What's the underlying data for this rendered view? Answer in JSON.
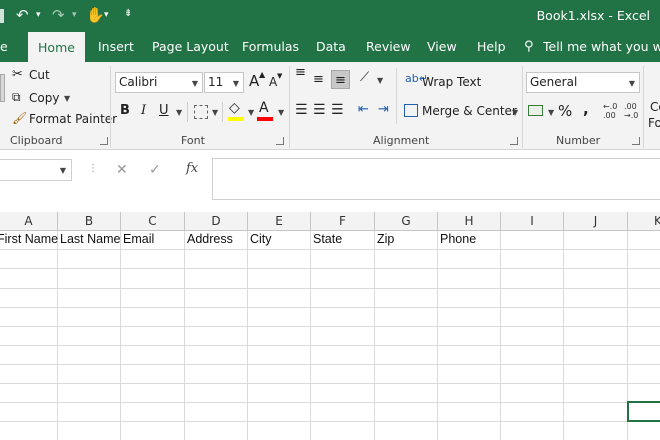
{
  "titlebar": {
    "title": "Book1.xlsx  -  Excel"
  },
  "tabs": [
    "e",
    "Home",
    "Insert",
    "Page Layout",
    "Formulas",
    "Data",
    "Review",
    "View",
    "Help"
  ],
  "tell_me": "Tell me what you want",
  "clipboard": {
    "cut": "Cut",
    "copy": "Copy",
    "format_painter": "Format Painter",
    "label": "Clipboard"
  },
  "font": {
    "name": "Calibri",
    "size": "11",
    "grow": "A",
    "shrink": "A",
    "bold": "B",
    "italic": "I",
    "underline": "U",
    "font_color": "A",
    "label": "Font"
  },
  "alignment": {
    "wrap_text": "Wrap Text",
    "merge_center": "Merge & Center",
    "label": "Alignment"
  },
  "number": {
    "format": "General",
    "currency": "$",
    "percent": "%",
    "comma": ")",
    "inc_decimal": ".00",
    "dec_decimal": ".0",
    "label": "Number"
  },
  "cond_format_partial": [
    "Co",
    "Fo"
  ],
  "formula_bar": {
    "cancel": "✕",
    "enter": "✓",
    "fx": "fx"
  },
  "columns": [
    "A",
    "B",
    "C",
    "D",
    "E",
    "F",
    "G",
    "H",
    "I",
    "J",
    "K"
  ],
  "header_row": [
    "First Name",
    "Last Name",
    "Email",
    "Address",
    "City",
    "State",
    "Zip",
    "Phone"
  ],
  "colors": {
    "brand": "#217346",
    "ribbon_bg": "#f3f3f3",
    "gridline": "#dadada"
  }
}
